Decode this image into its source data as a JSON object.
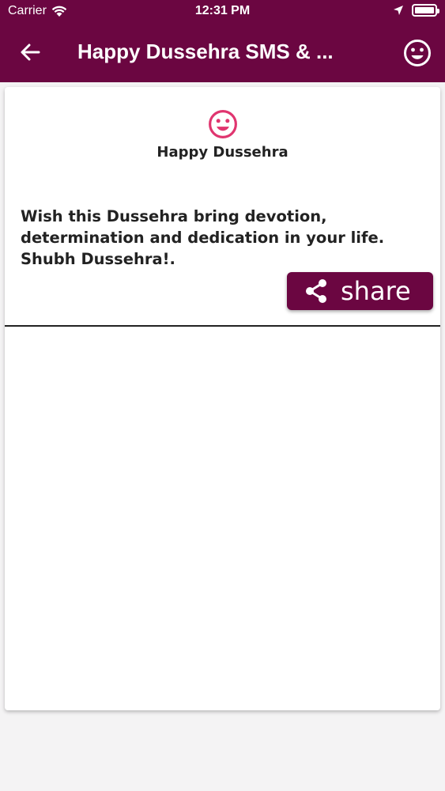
{
  "status_bar": {
    "carrier": "Carrier",
    "time": "12:31 PM"
  },
  "app_bar": {
    "title": "Happy Dussehra SMS & ...",
    "background_color": "#6b0641",
    "icons": {
      "back": "arrow-left-icon",
      "right": "smiley-face-icon"
    }
  },
  "card": {
    "icon": "smiley-face-icon",
    "icon_color": "#e0356f",
    "heading": "Happy Dussehra",
    "message": "Wish this Dussehra bring devotion, determination and dedication in your life. Shubh Dussehra!.",
    "share_button": {
      "label": "share",
      "icon": "share-icon",
      "color": "#6b0641"
    }
  }
}
